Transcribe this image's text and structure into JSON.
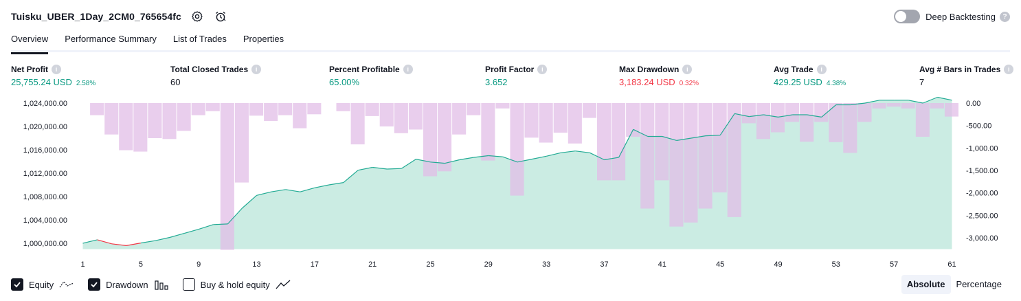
{
  "header": {
    "strategy_title": "Tuisku_UBER_1Day_2CM0_765654fc",
    "settings_icon": "gear-icon",
    "alert_icon": "alarm-clock-icon"
  },
  "deep_backtesting": {
    "label": "Deep Backtesting",
    "enabled": false,
    "help": "?"
  },
  "tabs": [
    {
      "label": "Overview",
      "active": true
    },
    {
      "label": "Performance Summary",
      "active": false
    },
    {
      "label": "List of Trades",
      "active": false
    },
    {
      "label": "Properties",
      "active": false
    }
  ],
  "metrics": [
    {
      "label": "Net Profit",
      "value": "25,755.24 USD",
      "sub": "2.58%",
      "color": "green"
    },
    {
      "label": "Total Closed Trades",
      "value": "60",
      "sub": "",
      "color": "plain"
    },
    {
      "label": "Percent Profitable",
      "value": "65.00%",
      "sub": "",
      "color": "green"
    },
    {
      "label": "Profit Factor",
      "value": "3.652",
      "sub": "",
      "color": "green"
    },
    {
      "label": "Max Drawdown",
      "value": "3,183.24 USD",
      "sub": "0.32%",
      "color": "red"
    },
    {
      "label": "Avg Trade",
      "value": "429.25 USD",
      "sub": "4.38%",
      "color": "green"
    },
    {
      "label": "Avg # Bars in Trades",
      "value": "7",
      "sub": "",
      "color": "plain"
    }
  ],
  "chart_data": {
    "type": "area",
    "x_tick_labels": [
      "1",
      "5",
      "9",
      "13",
      "17",
      "21",
      "25",
      "29",
      "33",
      "37",
      "41",
      "45",
      "49",
      "53",
      "57",
      "61"
    ],
    "left_axis": {
      "ticks": [
        "1,000,000.00",
        "1,004,000.00",
        "1,008,000.00",
        "1,012,000.00",
        "1,016,000.00",
        "1,020,000.00",
        "1,024,000.00"
      ],
      "ylim": [
        999000,
        1025000
      ]
    },
    "right_axis": {
      "ticks": [
        "0.00",
        "-500.00",
        "-1,000.00",
        "-1,500.00",
        "-2,000.00",
        "-2,500.00",
        "-3,000.00"
      ],
      "ylim": [
        -3200,
        0
      ]
    },
    "equity": [
      1000000,
      1000600,
      999900,
      999600,
      1000050,
      1000450,
      1001000,
      1001700,
      1002400,
      1003200,
      1003300,
      1006000,
      1008200,
      1008800,
      1009200,
      1008800,
      1009500,
      1010000,
      1010400,
      1012500,
      1013000,
      1012700,
      1012800,
      1014400,
      1013900,
      1013700,
      1014300,
      1014700,
      1015000,
      1014800,
      1013900,
      1014400,
      1014900,
      1015500,
      1015800,
      1015500,
      1014300,
      1014700,
      1019500,
      1018300,
      1018300,
      1017600,
      1018000,
      1018400,
      1018500,
      1022200,
      1021700,
      1022000,
      1021600,
      1022000,
      1022000,
      1021600,
      1023700,
      1023700,
      1024000,
      1024500,
      1024500,
      1024500,
      1024000,
      1025000,
      1024500
    ],
    "drawdown": [
      0,
      -270,
      -700,
      -1050,
      -1080,
      -780,
      -800,
      -620,
      -270,
      -180,
      -3270,
      -1770,
      -280,
      -400,
      -270,
      -560,
      -250,
      0,
      -180,
      -920,
      -290,
      -520,
      -670,
      -590,
      -1630,
      -1520,
      -700,
      -270,
      -1280,
      -120,
      -2060,
      -770,
      -880,
      -660,
      -900,
      -330,
      -1720,
      -1720,
      -750,
      -2350,
      -1720,
      -2750,
      -2660,
      -2350,
      -1990,
      -2540,
      -450,
      -800,
      -650,
      -420,
      -860,
      -420,
      -870,
      -1110,
      -420,
      -120,
      -80,
      -120,
      -750,
      -120,
      -300
    ],
    "series": [
      {
        "name": "Equity",
        "color": "#089981"
      },
      {
        "name": "Drawdown",
        "color": "#ce93d8"
      }
    ],
    "colors": {
      "equity_line": "#22ab94",
      "equity_line_below_start": "#f23645",
      "equity_fill": "#c8ebe1",
      "drawdown_fill": "#e1bee7"
    }
  },
  "legend": [
    {
      "label": "Equity",
      "checked": true,
      "icon": "equity-line-icon"
    },
    {
      "label": "Drawdown",
      "checked": true,
      "icon": "bars-icon"
    },
    {
      "label": "Buy & hold equity",
      "checked": false,
      "icon": "trend-line-icon"
    }
  ],
  "mode": {
    "absolute_label": "Absolute",
    "percentage_label": "Percentage",
    "selected": "Absolute"
  }
}
